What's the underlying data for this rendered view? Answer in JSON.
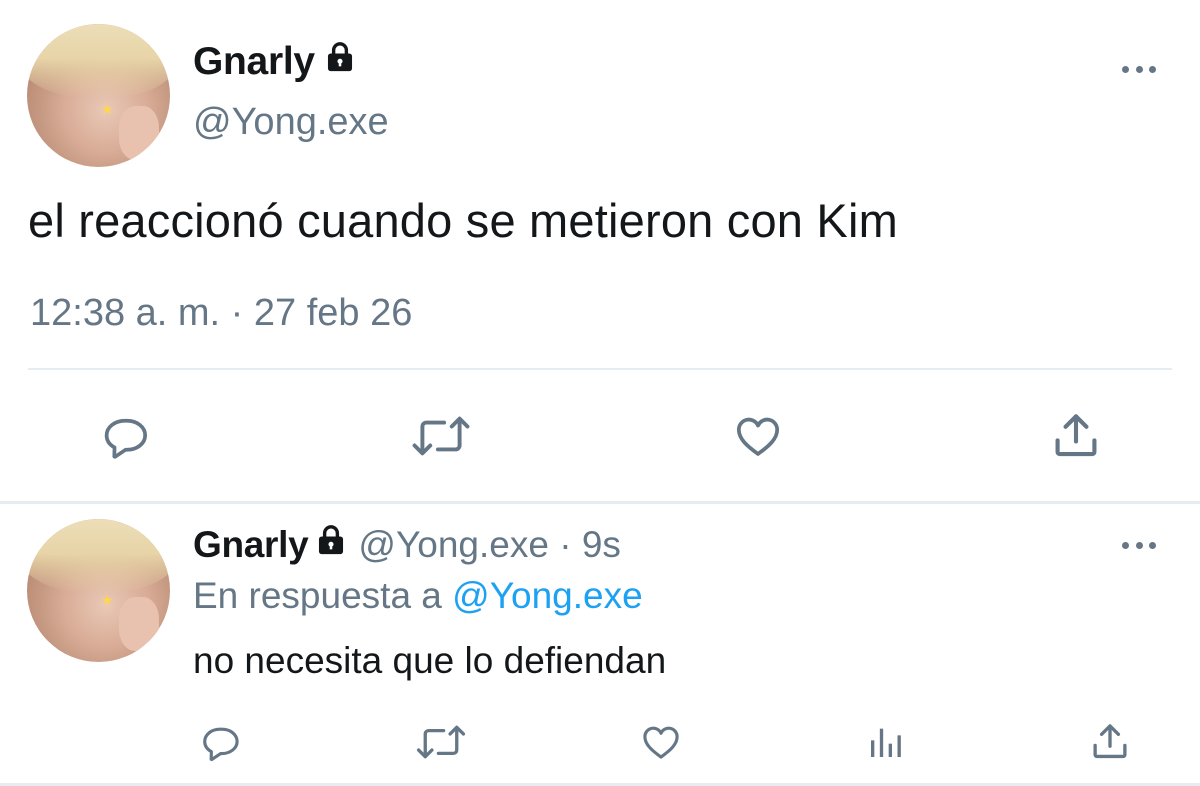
{
  "main_tweet": {
    "display_name": "Gnarly",
    "handle": "@Yong.exe",
    "text": "el reaccionó cuando se metieron con Kim",
    "timestamp": "12:38 a. m. · 27 feb 26",
    "actions": [
      "reply-icon",
      "retweet-icon",
      "like-icon",
      "share-icon"
    ],
    "more_icon": "more-options-icon"
  },
  "reply_tweet": {
    "display_name": "Gnarly",
    "handle_time": "@Yong.exe · 9s",
    "reply_prefix": "En respuesta a",
    "reply_mention": "@Yong.exe",
    "text": "no necesita que lo defiendan",
    "actions": [
      "reply-icon",
      "retweet-icon",
      "like-icon",
      "analytics-icon",
      "share-icon"
    ],
    "more_icon": "more-options-icon"
  },
  "colors": {
    "text_primary": "#14171a",
    "text_secondary": "#657786",
    "mention": "#1da1f2",
    "divider": "#e6ecf0"
  }
}
